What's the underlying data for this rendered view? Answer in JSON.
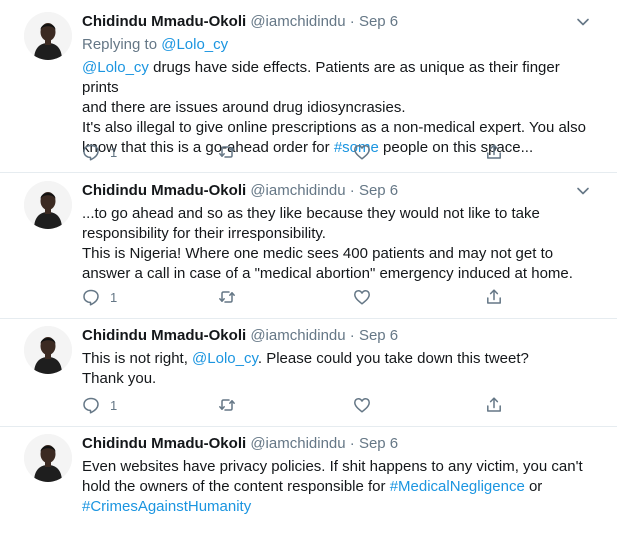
{
  "tweets": [
    {
      "name": "Chidindu Mmadu-Okoli",
      "handle": "@iamchidindu",
      "separator": "·",
      "date": "Sep 6",
      "replying_prefix": "Replying to",
      "replying_to": "@Lolo_cy",
      "body": {
        "mention": "@Lolo_cy",
        "l1_rest": " drugs have side effects. Patients are as unique as their finger prints",
        "l2": "and there are issues around drug idiosyncrasies.",
        "l3": "It's also illegal to give online prescriptions as a non-medical expert. You also",
        "l4_pre": "know that this is a go-ahead order for ",
        "hashtag": "#some",
        "l4_post": " people on this space..."
      },
      "reply_count": "1"
    },
    {
      "name": "Chidindu Mmadu-Okoli",
      "handle": "@iamchidindu",
      "separator": "·",
      "date": "Sep 6",
      "body": {
        "l1": "...to go ahead and so as they like because they would not like to take",
        "l2": "responsibility for their irresponsibility.",
        "l3": "This is Nigeria! Where one medic sees 400 patients and may not get to",
        "l4": "answer a call in case of a \"medical abortion\" emergency induced at home."
      },
      "reply_count": "1"
    },
    {
      "name": "Chidindu Mmadu-Okoli",
      "handle": "@iamchidindu",
      "separator": "·",
      "date": "Sep 6",
      "body": {
        "l1_pre": "This is not right, ",
        "mention": "@Lolo_cy",
        "l1_post": ". Please could you take down this tweet?",
        "l2": "Thank you."
      },
      "reply_count": "1"
    },
    {
      "name": "Chidindu Mmadu-Okoli",
      "handle": "@iamchidindu",
      "separator": "·",
      "date": "Sep 6",
      "body": {
        "l1": "Even websites have privacy policies. If shit happens to any victim, you can't",
        "l2_pre": "hold the owners of the content responsible for ",
        "hashtag1": "#MedicalNegligence",
        "l2_post": " or",
        "hashtag2": "#CrimesAgainstHumanity"
      }
    }
  ],
  "icons": {
    "reply": "reply-icon",
    "retweet": "retweet-icon",
    "like": "like-icon",
    "share": "share-icon",
    "more": "chevron-down-icon"
  },
  "colors": {
    "link": "#1b95e0",
    "secondary_text": "#657786",
    "divider": "#e6ecf0"
  }
}
